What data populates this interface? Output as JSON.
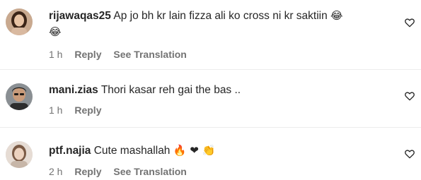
{
  "comments": [
    {
      "username": "rijawaqas25",
      "text_line1": "Ap jo bh kr lain fizza ali ko cross ni kr saktiin",
      "emoji_inline": "😂",
      "emoji_line2": "😂",
      "time": "1 h",
      "reply": "Reply",
      "translation": "See Translation"
    },
    {
      "username": "mani.zias",
      "text_line1": "Thori kasar reh gai the bas ..",
      "time": "1 h",
      "reply": "Reply"
    },
    {
      "username": "ptf.najia",
      "text_line1": "Cute mashallah",
      "emojis": "🔥 ❤ 👏",
      "time": "2 h",
      "reply": "Reply",
      "translation": "See Translation"
    }
  ],
  "icons": {
    "like": "heart-outline-icon",
    "accent": "#262626",
    "meta_color": "#737373"
  }
}
